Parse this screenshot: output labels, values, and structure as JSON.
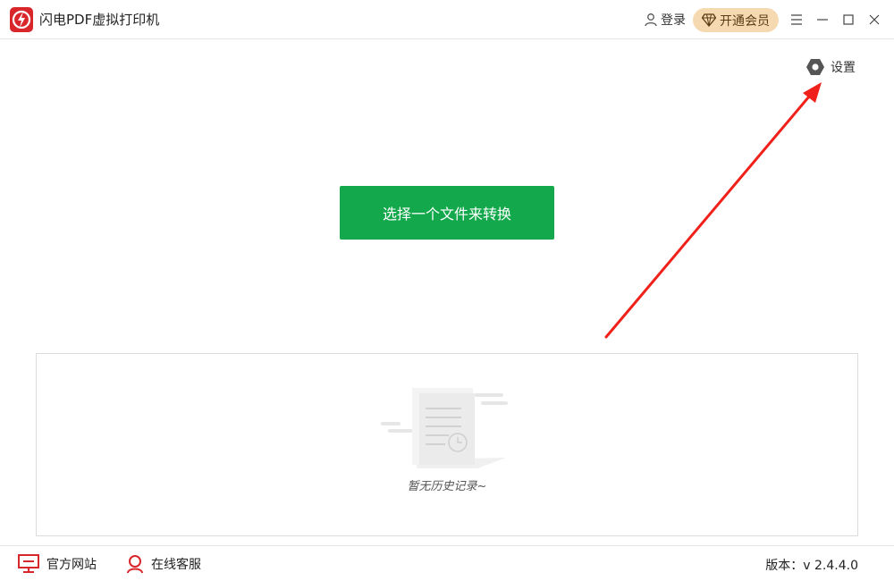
{
  "app": {
    "title": "闪电PDF虚拟打印机"
  },
  "titlebar": {
    "login_label": "登录",
    "vip_label": "开通会员",
    "controls": [
      "menu-icon",
      "minimize-icon",
      "maximize-icon",
      "close-icon"
    ]
  },
  "settings": {
    "label": "设置",
    "icon": "gear-icon"
  },
  "main": {
    "select_button_label": "选择一个文件来转换"
  },
  "history": {
    "empty_text": "暂无历史记录~",
    "icon": "empty-document-icon"
  },
  "footer": {
    "website_label": "官方网站",
    "support_label": "在线客服",
    "version_label": "版本：",
    "version_value": "v 2.4.4.0"
  },
  "colors": {
    "primary_green": "#12a84b",
    "brand_red": "#d9262b",
    "vip_gold": "#f5d9b0",
    "annotation_arrow": "#f0201a"
  }
}
